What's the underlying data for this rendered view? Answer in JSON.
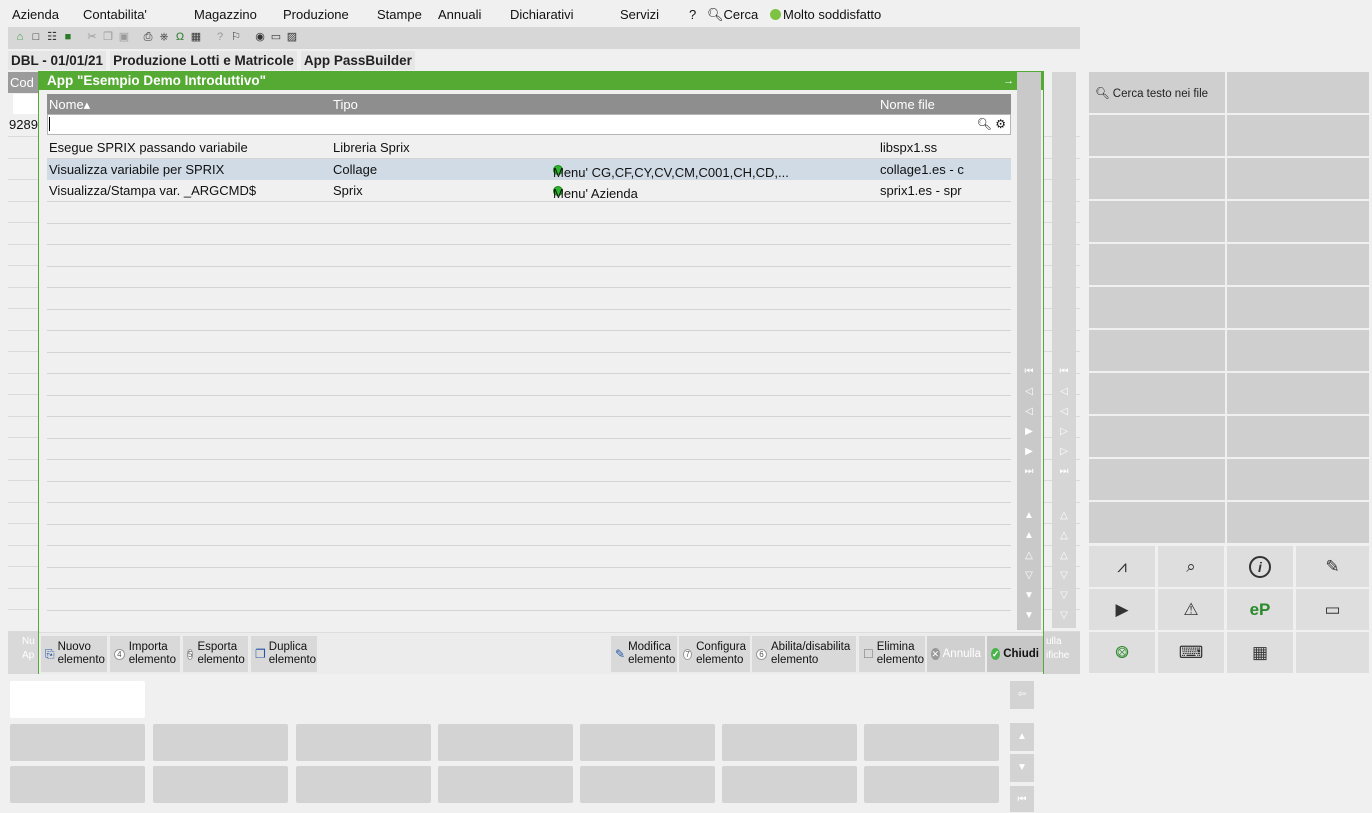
{
  "menu": {
    "items": [
      "Azienda",
      "Contabilita'",
      "Magazzino",
      "Produzione",
      "Stampe",
      "Annuali",
      "Dichiarativi",
      "Servizi",
      "?",
      "Cerca",
      "Molto soddisfatto"
    ]
  },
  "breadcrumb": [
    "DBL - 01/01/21",
    "Produzione Lotti e Matricole",
    "App PassBuilder"
  ],
  "background": {
    "col_header": "Cod",
    "code": "9289"
  },
  "dialog": {
    "title": "App \"Esempio Demo Introduttivo\"",
    "columns": {
      "name": "Nome▴",
      "type": "Tipo",
      "file": "Nome file"
    },
    "rows": [
      {
        "name": "Esegue SPRIX passando variabile",
        "type": "Libreria Sprix",
        "menu": "",
        "file": "libspx1.ss"
      },
      {
        "name": "Visualizza variabile per SPRIX",
        "type": "Collage",
        "menu": "Menu' CG,CF,CY,CV,CM,C001,CH,CD,...",
        "file": "collage1.es - c"
      },
      {
        "name": "Visualizza/Stampa var. _ARGCMD$",
        "type": "Sprix",
        "menu": "Menu' Azienda",
        "file": "sprix1.es - spr"
      }
    ],
    "footer": {
      "nuovo": [
        "Nuovo",
        "elemento"
      ],
      "importa": [
        "Importa",
        "elemento"
      ],
      "esporta": [
        "Esporta",
        "elemento"
      ],
      "duplica": [
        "Duplica",
        "elemento"
      ],
      "modifica": [
        "Modifica",
        "elemento"
      ],
      "configura": [
        "Configura",
        "elemento"
      ],
      "abilita": [
        "Abilita/disabilita",
        "elemento"
      ],
      "elimina": [
        "Elimina",
        "elemento"
      ],
      "annulla": "Annulla",
      "chiudi": "Chiudi"
    },
    "footer_nums": {
      "importa": "4",
      "esporta": "5",
      "configura": "7",
      "abilita": "6"
    }
  },
  "behind_footer": {
    "left_top": "Nu",
    "left_bottom": "Ap",
    "right_top": "ulla",
    "right_bottom": "ifiche"
  },
  "right_panel": {
    "search_label": "Cerca testo nei file"
  },
  "colors": {
    "accent": "#55aa33",
    "header": "#8e8e8e",
    "selected_row": "#d0dbe6"
  }
}
